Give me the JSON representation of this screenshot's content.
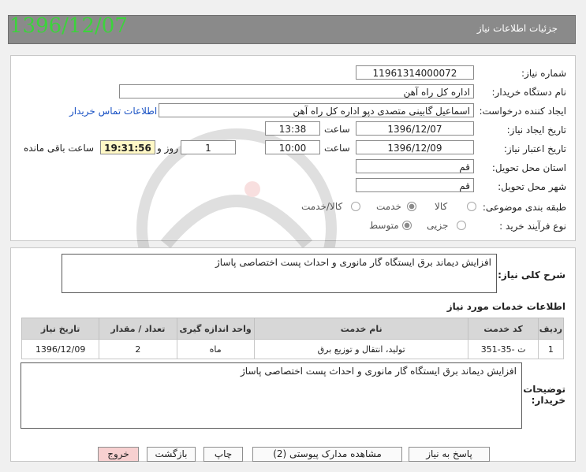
{
  "header": {
    "title": "جزئیات اطلاعات نیاز",
    "date_big": "1396/12/07"
  },
  "form": {
    "need_number_label": "شماره نیاز:",
    "need_number": "11961314000072",
    "buyer_org_label": "نام دستگاه خریدار:",
    "buyer_org": "اداره کل راه آهن",
    "requester_label": "ایجاد کننده درخواست:",
    "requester": "اسماعیل  گابینی متصدی دپو اداره کل راه آهن",
    "contact_link": "اطلاعات تماس خریدار",
    "created_label": "تاریخ ایجاد نیاز:",
    "created_date": "1396/12/07",
    "time_label": "ساعت",
    "created_time": "13:38",
    "valid_label": "تاریخ اعتبار نیاز:",
    "valid_date": "1396/12/09",
    "valid_time": "10:00",
    "days_value": "1",
    "days_label": "روز و",
    "remaining_time": "19:31:56",
    "remaining_label": "ساعت باقی مانده",
    "province_label": "استان محل تحویل:",
    "province": "قم",
    "city_label": "شهر محل تحویل:",
    "city": "قم",
    "category_label": "طبقه بندی موضوعی:",
    "category_options": [
      "کالا",
      "خدمت",
      "کالا/خدمت"
    ],
    "category_selected": "خدمت",
    "process_label": "نوع فرآیند خرید :",
    "process_options": [
      "جزیی",
      "متوسط"
    ],
    "process_selected": "متوسط"
  },
  "summary": {
    "label": "شرح کلی نیاز:",
    "text": "افزایش دیماند برق ایستگاه گار مانوری و احداث پست اختصاصی پاساژ"
  },
  "services": {
    "section_title": "اطلاعات خدمات مورد نیاز",
    "columns": [
      "ردیف",
      "کد خدمت",
      "نام خدمت",
      "واحد اندازه گیری",
      "تعداد / مقدار",
      "تاریخ نیاز"
    ],
    "rows": [
      [
        "1",
        "ت -35-351",
        "تولید، انتقال و توزیع برق",
        "ماه",
        "2",
        "1396/12/09"
      ]
    ]
  },
  "notes": {
    "label": "توضیحات خریدار:",
    "text": "افزایش دیماند برق ایستگاه گار مانوری و احداث پست اختصاصی پاساژ"
  },
  "buttons": {
    "reply": "پاسخ به نیاز",
    "attachments": "مشاهده مدارک پیوستی (2)",
    "print": "چاپ",
    "back": "بازگشت",
    "exit": "خروج"
  },
  "colors": {
    "header_bg": "#8a8a8a",
    "date_green": "#3bd43b",
    "timer_bg": "#fff8c6",
    "exit_bg": "#f7d0d0"
  }
}
